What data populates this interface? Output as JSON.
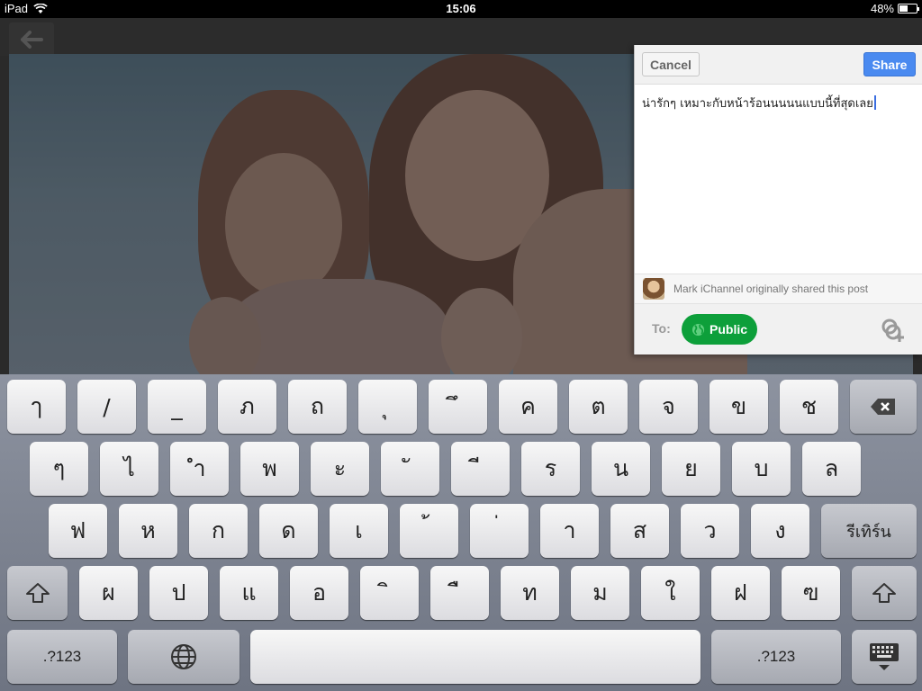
{
  "status_bar": {
    "device": "iPad",
    "time": "15:06",
    "battery": "48%",
    "battery_level": 0.48
  },
  "share_panel": {
    "cancel_label": "Cancel",
    "share_label": "Share",
    "compose_text": "น่ารักๆ เหมาะกับหน้าร้อนนนนนแบบนี้ที่สุดเลย",
    "attribution": "Mark iChannel originally shared this post",
    "to_label": "To:",
    "audience": "Public"
  },
  "keyboard": {
    "row1": [
      "ๅ",
      "/",
      "_",
      "ภ",
      "ถ",
      "ุ",
      "ึ",
      "ค",
      "ต",
      "จ",
      "ข",
      "ช"
    ],
    "row2": [
      "ๆ",
      "ไ",
      "ำ",
      "พ",
      "ะ",
      "ั",
      "ี",
      "ร",
      "น",
      "ย",
      "บ",
      "ล"
    ],
    "row3": [
      "ฟ",
      "ห",
      "ก",
      "ด",
      "เ",
      "้",
      "่",
      "า",
      "ส",
      "ว",
      "ง"
    ],
    "return_label": "รีเทิร์น",
    "row4": [
      "ผ",
      "ป",
      "แ",
      "อ",
      "ิ",
      "ื",
      "ท",
      "ม",
      "ใ",
      "ฝ",
      "ฃ"
    ],
    "numbers_label": ".?123",
    "icons": {
      "backspace": "backspace-icon",
      "shift": "shift-icon",
      "globe": "globe-icon",
      "hide": "keyboard-hide-icon"
    }
  },
  "colors": {
    "share_blue": "#4a8af0",
    "public_green": "#0d9f3a"
  }
}
